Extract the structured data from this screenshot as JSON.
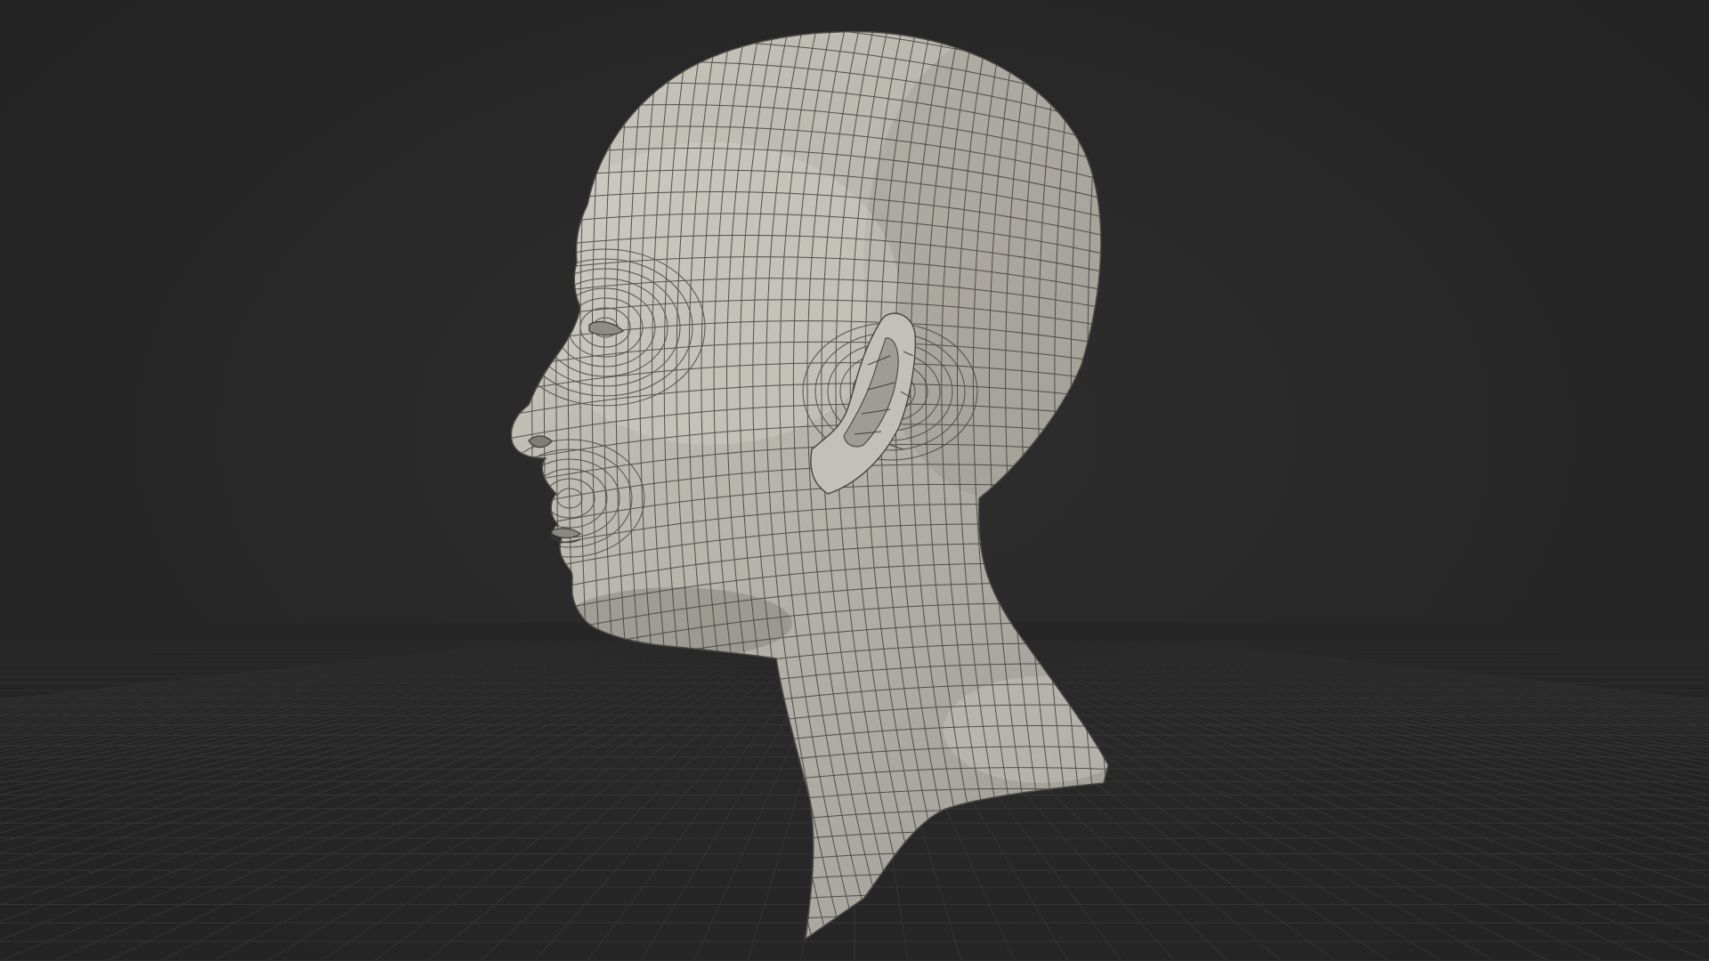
{
  "viewport": {
    "background_color": "#262626",
    "grid_color": "#3a3a3a",
    "model_fill_color": "#b8b6ad",
    "model_wire_color": "#3f3e3a",
    "icons": [
      "head-mesh-wireframe",
      "ground-grid"
    ]
  }
}
